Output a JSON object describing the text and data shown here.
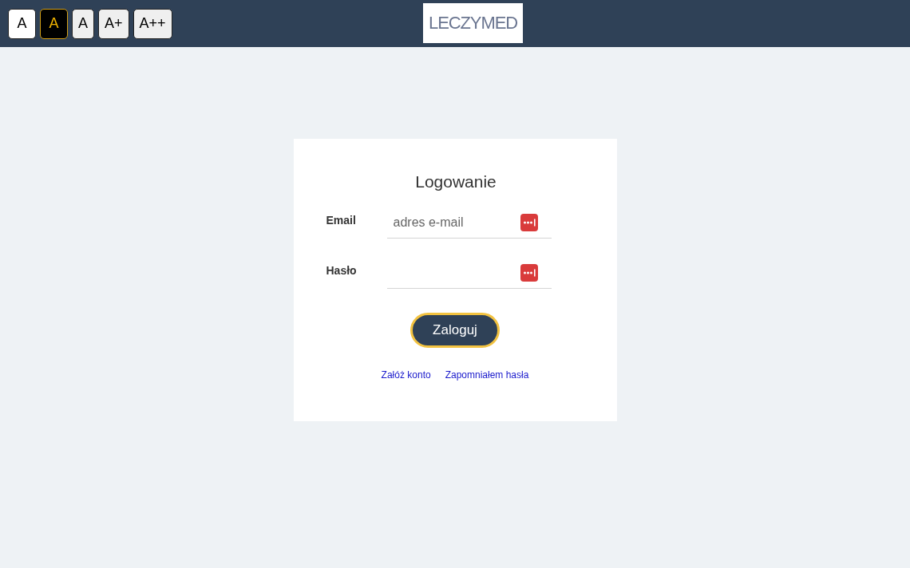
{
  "toolbar": [
    {
      "label": "A",
      "kind": "light"
    },
    {
      "label": "A",
      "kind": "dark"
    },
    {
      "label": "A",
      "kind": "size"
    },
    {
      "label": "A+",
      "kind": "size"
    },
    {
      "label": "A++",
      "kind": "size"
    }
  ],
  "logo": {
    "text": "LECZYMED"
  },
  "login": {
    "title": "Logowanie",
    "fields": [
      {
        "label": "Email",
        "placeholder": "adres e-mail"
      },
      {
        "label": "Hasło"
      }
    ],
    "button": "Zaloguj",
    "links": [
      "Załóż konto",
      "Zapomniałem hasła"
    ]
  }
}
